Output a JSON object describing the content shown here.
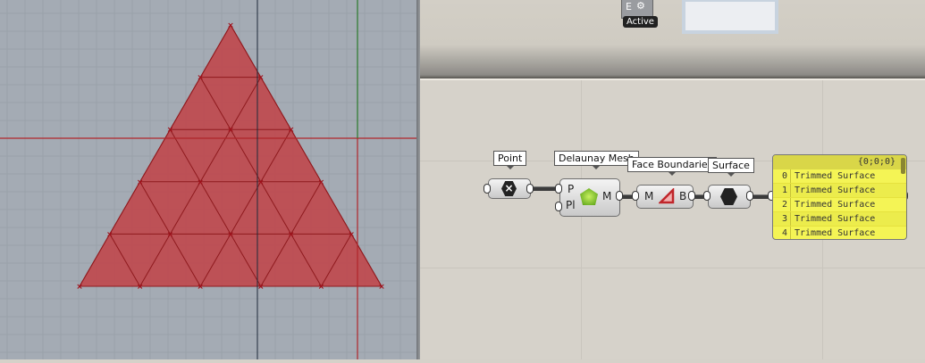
{
  "viewport": {
    "mesh_color": "#c0474b",
    "axis_x_color": "#b0252a",
    "axis_y_color": "#2a7a2a"
  },
  "canvas": {
    "top_component": {
      "input": "E",
      "status": "Active"
    },
    "components": {
      "point": {
        "label": "Point"
      },
      "delaunay": {
        "label": "Delaunay Mesh",
        "inputs": [
          "P",
          "Pl"
        ],
        "output": "M"
      },
      "face_boundaries": {
        "label": "Face Boundaries",
        "input": "M",
        "output": "B"
      },
      "surface": {
        "label": "Surface"
      }
    },
    "panel": {
      "path": "{0;0;0}",
      "items": [
        {
          "index": "0",
          "value": "Trimmed Surface"
        },
        {
          "index": "1",
          "value": "Trimmed Surface"
        },
        {
          "index": "2",
          "value": "Trimmed Surface"
        },
        {
          "index": "3",
          "value": "Trimmed Surface"
        },
        {
          "index": "4",
          "value": "Trimmed Surface"
        }
      ]
    }
  }
}
